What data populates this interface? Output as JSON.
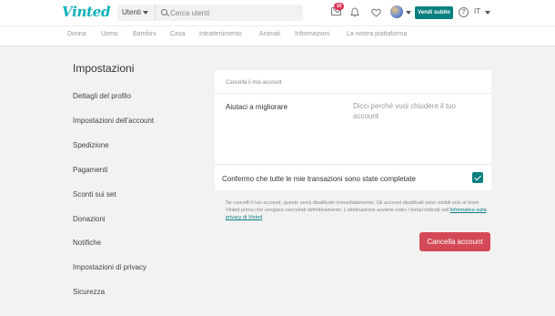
{
  "header": {
    "logo": "Vinted",
    "search": {
      "category": "Utenti",
      "placeholder": "Cerca utenti"
    },
    "inbox_badge": "10",
    "sell_label": "Vendi subito",
    "help_glyph": "?",
    "language": "IT",
    "icons": [
      "inbox-icon",
      "bell-icon",
      "heart-icon",
      "help-icon"
    ]
  },
  "nav": {
    "items": [
      "Donna",
      "Uomo",
      "Bambini",
      "Casa",
      "Intrattenimento",
      "Animali",
      "Informazioni",
      "La nostra piattaforma"
    ]
  },
  "sidebar": {
    "title": "Impostazioni",
    "items": [
      "Dettagli del profilo",
      "Impostazioni dell'account",
      "Spedizione",
      "Pagamenti",
      "Sconti sui set",
      "Donazioni",
      "Notifiche",
      "Impostazioni di privacy",
      "Sicurezza"
    ]
  },
  "form": {
    "header": "Cancella il mio account",
    "reason_label": "Aiutaci a migliorare",
    "reason_placeholder": "Dicci perché vuoi chiudere il tuo account",
    "confirm_label": "Confermo che tutte le mie transazioni sono state completate",
    "confirm_checked": true,
    "notice_text": "Se cancelli il tuo account, questo verrà disattivato immediatamente. Gli account disattivati sono visibili solo al team Vinted prima che vengano cancellati definitivamente. L'eliminazione avviene entro i tempi indicati nell'",
    "notice_link": "Informativa sulla privacy di Vinted",
    "notice_end": ".",
    "submit_label": "Cancella account"
  },
  "colors": {
    "brand": "#09b1ba",
    "primary": "#09807f",
    "danger": "#d44957",
    "badge": "#e0355a",
    "background": "#f2f2f2"
  }
}
